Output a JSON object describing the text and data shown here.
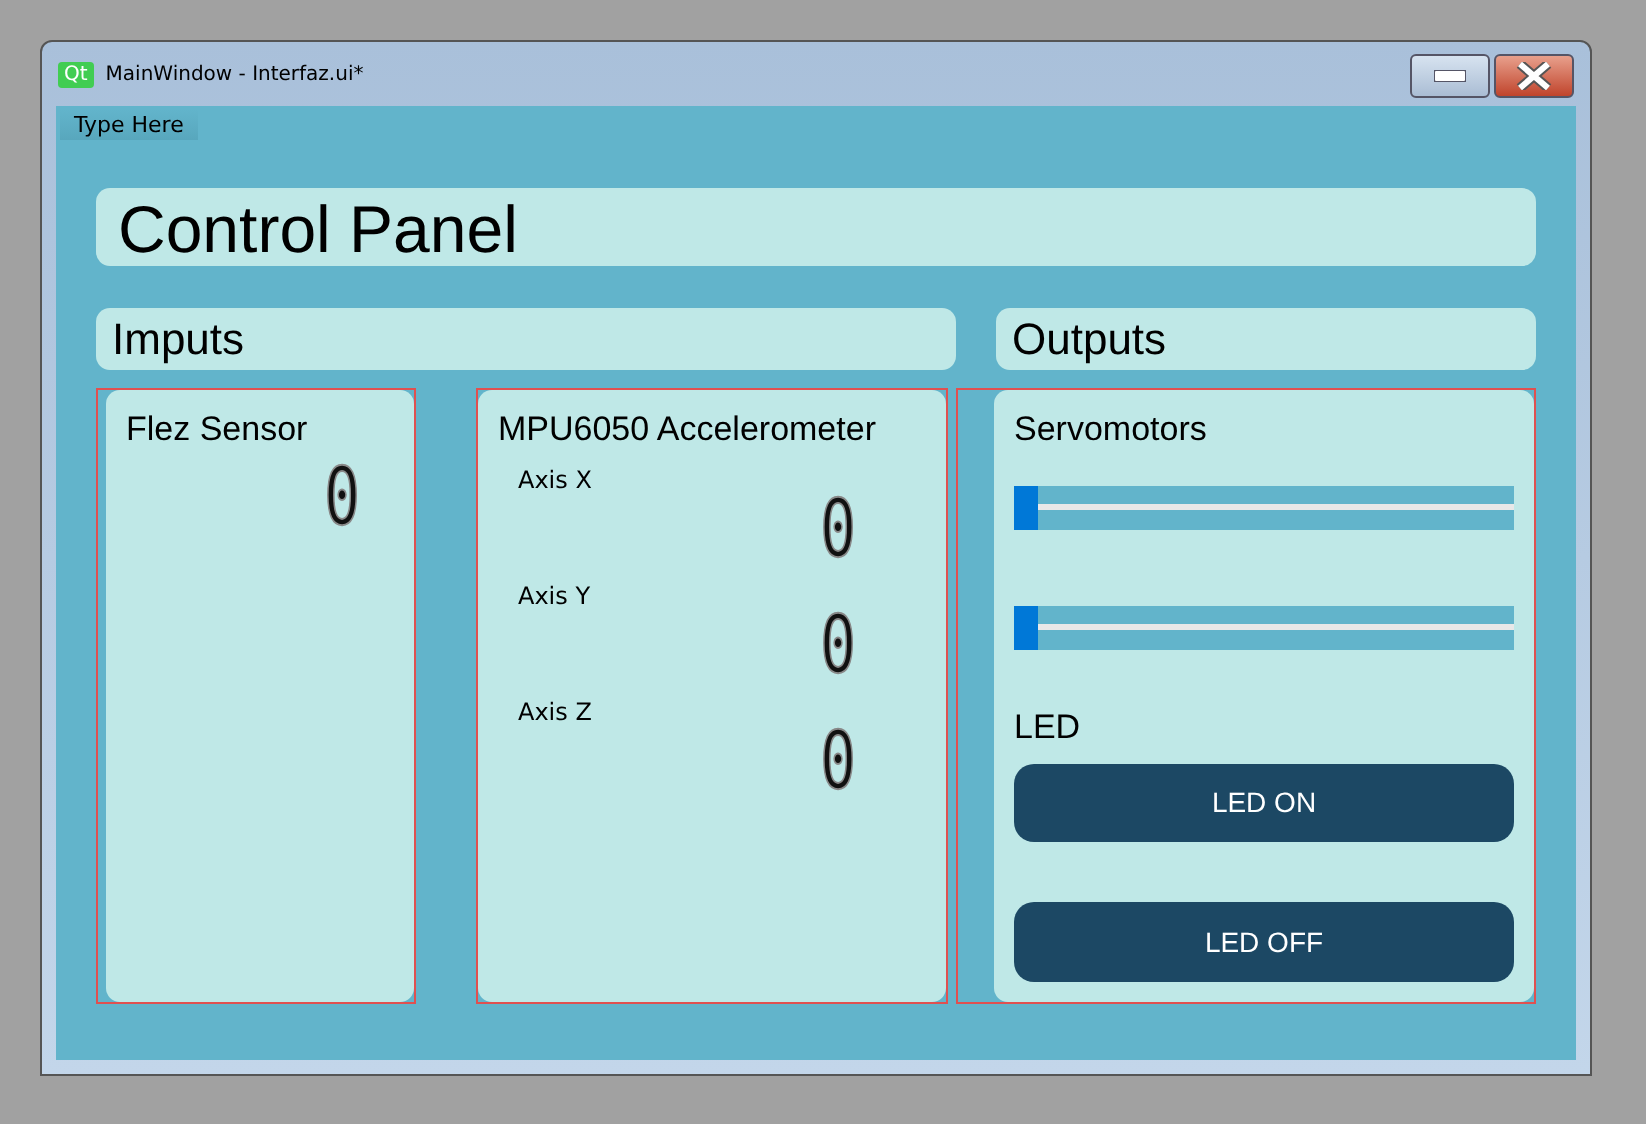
{
  "window": {
    "title": "MainWindow - Interfaz.ui*",
    "logo": "Qt"
  },
  "menu": {
    "placeholder": "Type Here"
  },
  "header": "Control Panel",
  "inputs": {
    "title": "Imputs",
    "flex": {
      "title": "Flez Sensor",
      "value": "0"
    },
    "mpu": {
      "title": "MPU6050 Accelerometer",
      "axes": [
        {
          "label": "Axis X",
          "value": "0"
        },
        {
          "label": "Axis Y",
          "value": "0"
        },
        {
          "label": "Axis Z",
          "value": "0"
        }
      ]
    }
  },
  "outputs": {
    "title": "Outputs",
    "servo_title": "Servomotors",
    "sliders": [
      {
        "level": 0
      },
      {
        "level": 0
      }
    ],
    "led_title": "LED",
    "buttons": [
      "LED ON",
      "LED OFF"
    ]
  }
}
